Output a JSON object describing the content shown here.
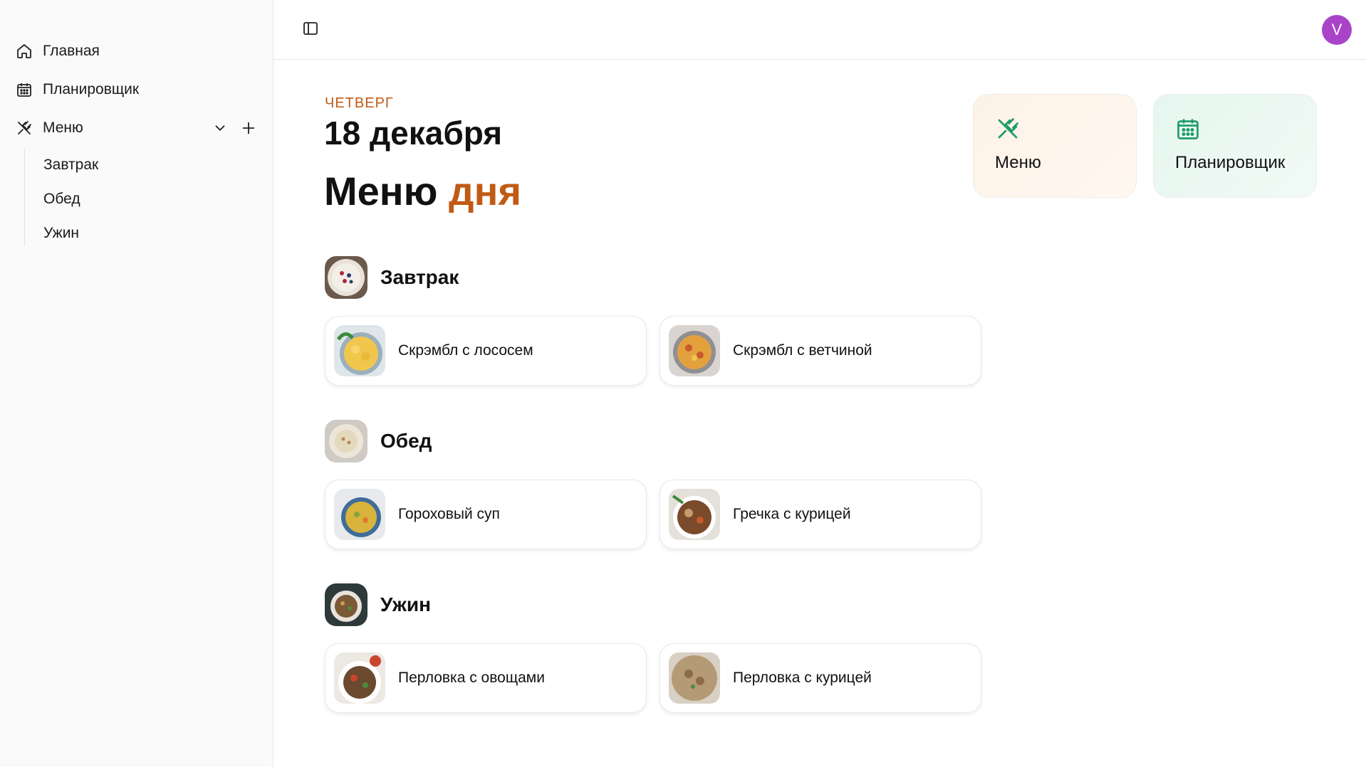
{
  "sidebar": {
    "items": [
      {
        "label": "Главная",
        "icon": "home-icon"
      },
      {
        "label": "Планировщик",
        "icon": "calendar-icon"
      },
      {
        "label": "Меню",
        "icon": "utensils-icon"
      }
    ],
    "submenu": [
      "Завтрак",
      "Обед",
      "Ужин"
    ]
  },
  "header": {
    "avatar_letter": "V",
    "avatar_color": "#a944c9"
  },
  "main": {
    "weekday": "ЧЕТВЕРГ",
    "date": "18 декабря",
    "title_main": "Меню",
    "title_accent": "дня",
    "accent_color": "#c05a14"
  },
  "quick_links": [
    {
      "label": "Меню",
      "icon": "utensils-icon",
      "color": "#1f9d6b"
    },
    {
      "label": "Планировщик",
      "icon": "calendar-icon",
      "color": "#1f9d6b"
    }
  ],
  "meals": [
    {
      "title": "Завтрак",
      "dishes": [
        "Скрэмбл с лососем",
        "Скрэмбл с ветчиной"
      ]
    },
    {
      "title": "Обед",
      "dishes": [
        "Гороховый суп",
        "Гречка с курицей"
      ]
    },
    {
      "title": "Ужин",
      "dishes": [
        "Перловка с овощами",
        "Перловка с курицей"
      ]
    }
  ]
}
